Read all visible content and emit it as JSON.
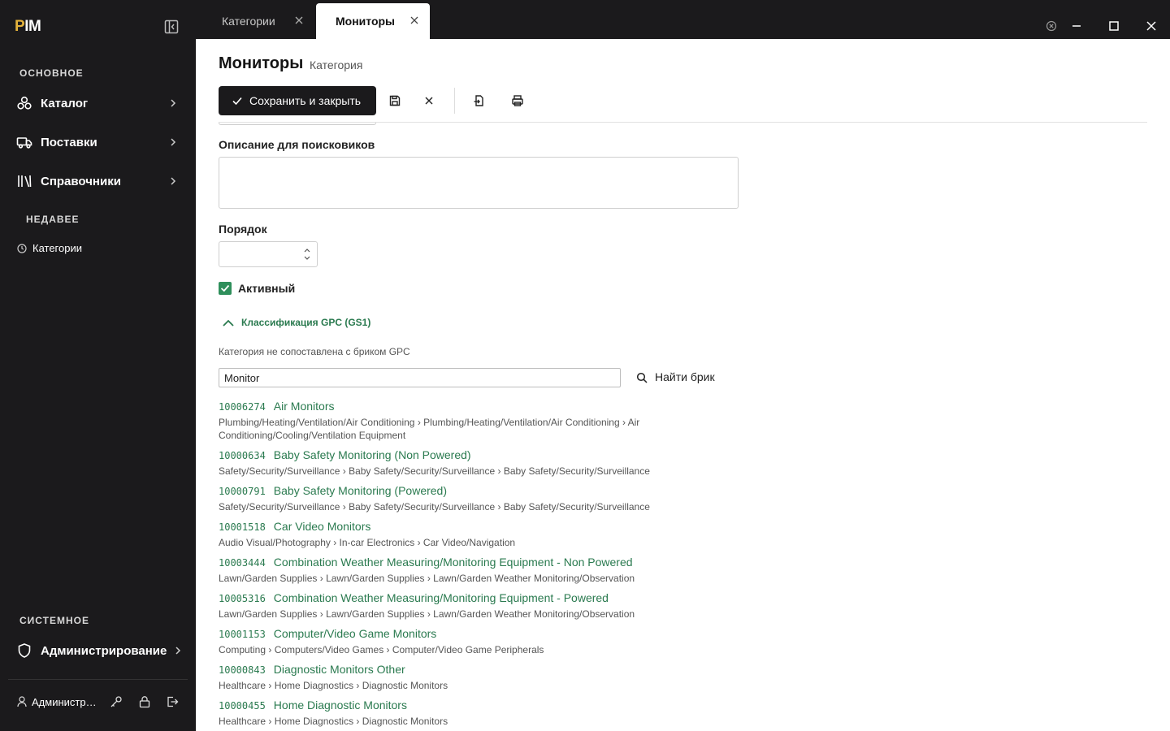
{
  "sidebar": {
    "logo": {
      "prefix": "P",
      "rest": "IM"
    },
    "sections": {
      "main": "ОСНОВНОЕ",
      "recent": "НЕДАВЕЕ",
      "system": "СИСТЕМНОЕ"
    },
    "items": [
      {
        "label": "Каталог",
        "icon": "catalog-icon"
      },
      {
        "label": "Поставки",
        "icon": "truck-icon"
      },
      {
        "label": "Справочники",
        "icon": "library-icon"
      }
    ],
    "recent": [
      {
        "label": "Категории",
        "icon": "clock-icon"
      }
    ],
    "admin": {
      "label": "Администрирование",
      "icon": "shield-icon"
    },
    "user": {
      "name": "Администратор"
    }
  },
  "tabs": [
    {
      "label": "Категории",
      "active": false
    },
    {
      "label": "Мониторы",
      "active": true
    }
  ],
  "page": {
    "title": "Мониторы",
    "subtitle": "Категория"
  },
  "toolbar": {
    "save_close_label": "Сохранить и закрыть"
  },
  "form": {
    "seo_description_label": "Описание для поисковиков",
    "seo_description_value": "",
    "order_label": "Порядок",
    "order_value": "",
    "active_label": "Активный",
    "active_checked": true,
    "gpc_section_label": "Классификация GPC (GS1)",
    "gpc_note": "Категория не сопоставлена с бриком GPC",
    "search_value": "Monitor",
    "find_button_label": "Найти брик"
  },
  "results": [
    {
      "code": "10006274",
      "name": "Air Monitors",
      "path": "Plumbing/Heating/Ventilation/Air Conditioning › Plumbing/Heating/Ventilation/Air Conditioning › Air Conditioning/Cooling/Ventilation Equipment"
    },
    {
      "code": "10000634",
      "name": "Baby Safety Monitoring (Non Powered)",
      "path": "Safety/Security/Surveillance › Baby Safety/Security/Surveillance › Baby Safety/Security/Surveillance"
    },
    {
      "code": "10000791",
      "name": "Baby Safety Monitoring (Powered)",
      "path": "Safety/Security/Surveillance › Baby Safety/Security/Surveillance › Baby Safety/Security/Surveillance"
    },
    {
      "code": "10001518",
      "name": "Car Video Monitors",
      "path": "Audio Visual/Photography › In-car Electronics › Car Video/Navigation"
    },
    {
      "code": "10003444",
      "name": "Combination Weather Measuring/Monitoring Equipment - Non Powered",
      "path": "Lawn/Garden Supplies › Lawn/Garden Supplies › Lawn/Garden Weather Monitoring/Observation"
    },
    {
      "code": "10005316",
      "name": "Combination Weather Measuring/Monitoring Equipment - Powered",
      "path": "Lawn/Garden Supplies › Lawn/Garden Supplies › Lawn/Garden Weather Monitoring/Observation"
    },
    {
      "code": "10001153",
      "name": "Computer/Video Game Monitors",
      "path": "Computing › Computers/Video Games › Computer/Video Game Peripherals"
    },
    {
      "code": "10000843",
      "name": "Diagnostic Monitors Other",
      "path": "Healthcare › Home Diagnostics › Diagnostic Monitors"
    },
    {
      "code": "10000455",
      "name": "Home Diagnostic Monitors",
      "path": "Healthcare › Home Diagnostics › Diagnostic Monitors"
    }
  ],
  "colors": {
    "accent_green": "#2a7a4f",
    "dark": "#1b1a1c",
    "logo_yellow": "#e3b23c"
  }
}
